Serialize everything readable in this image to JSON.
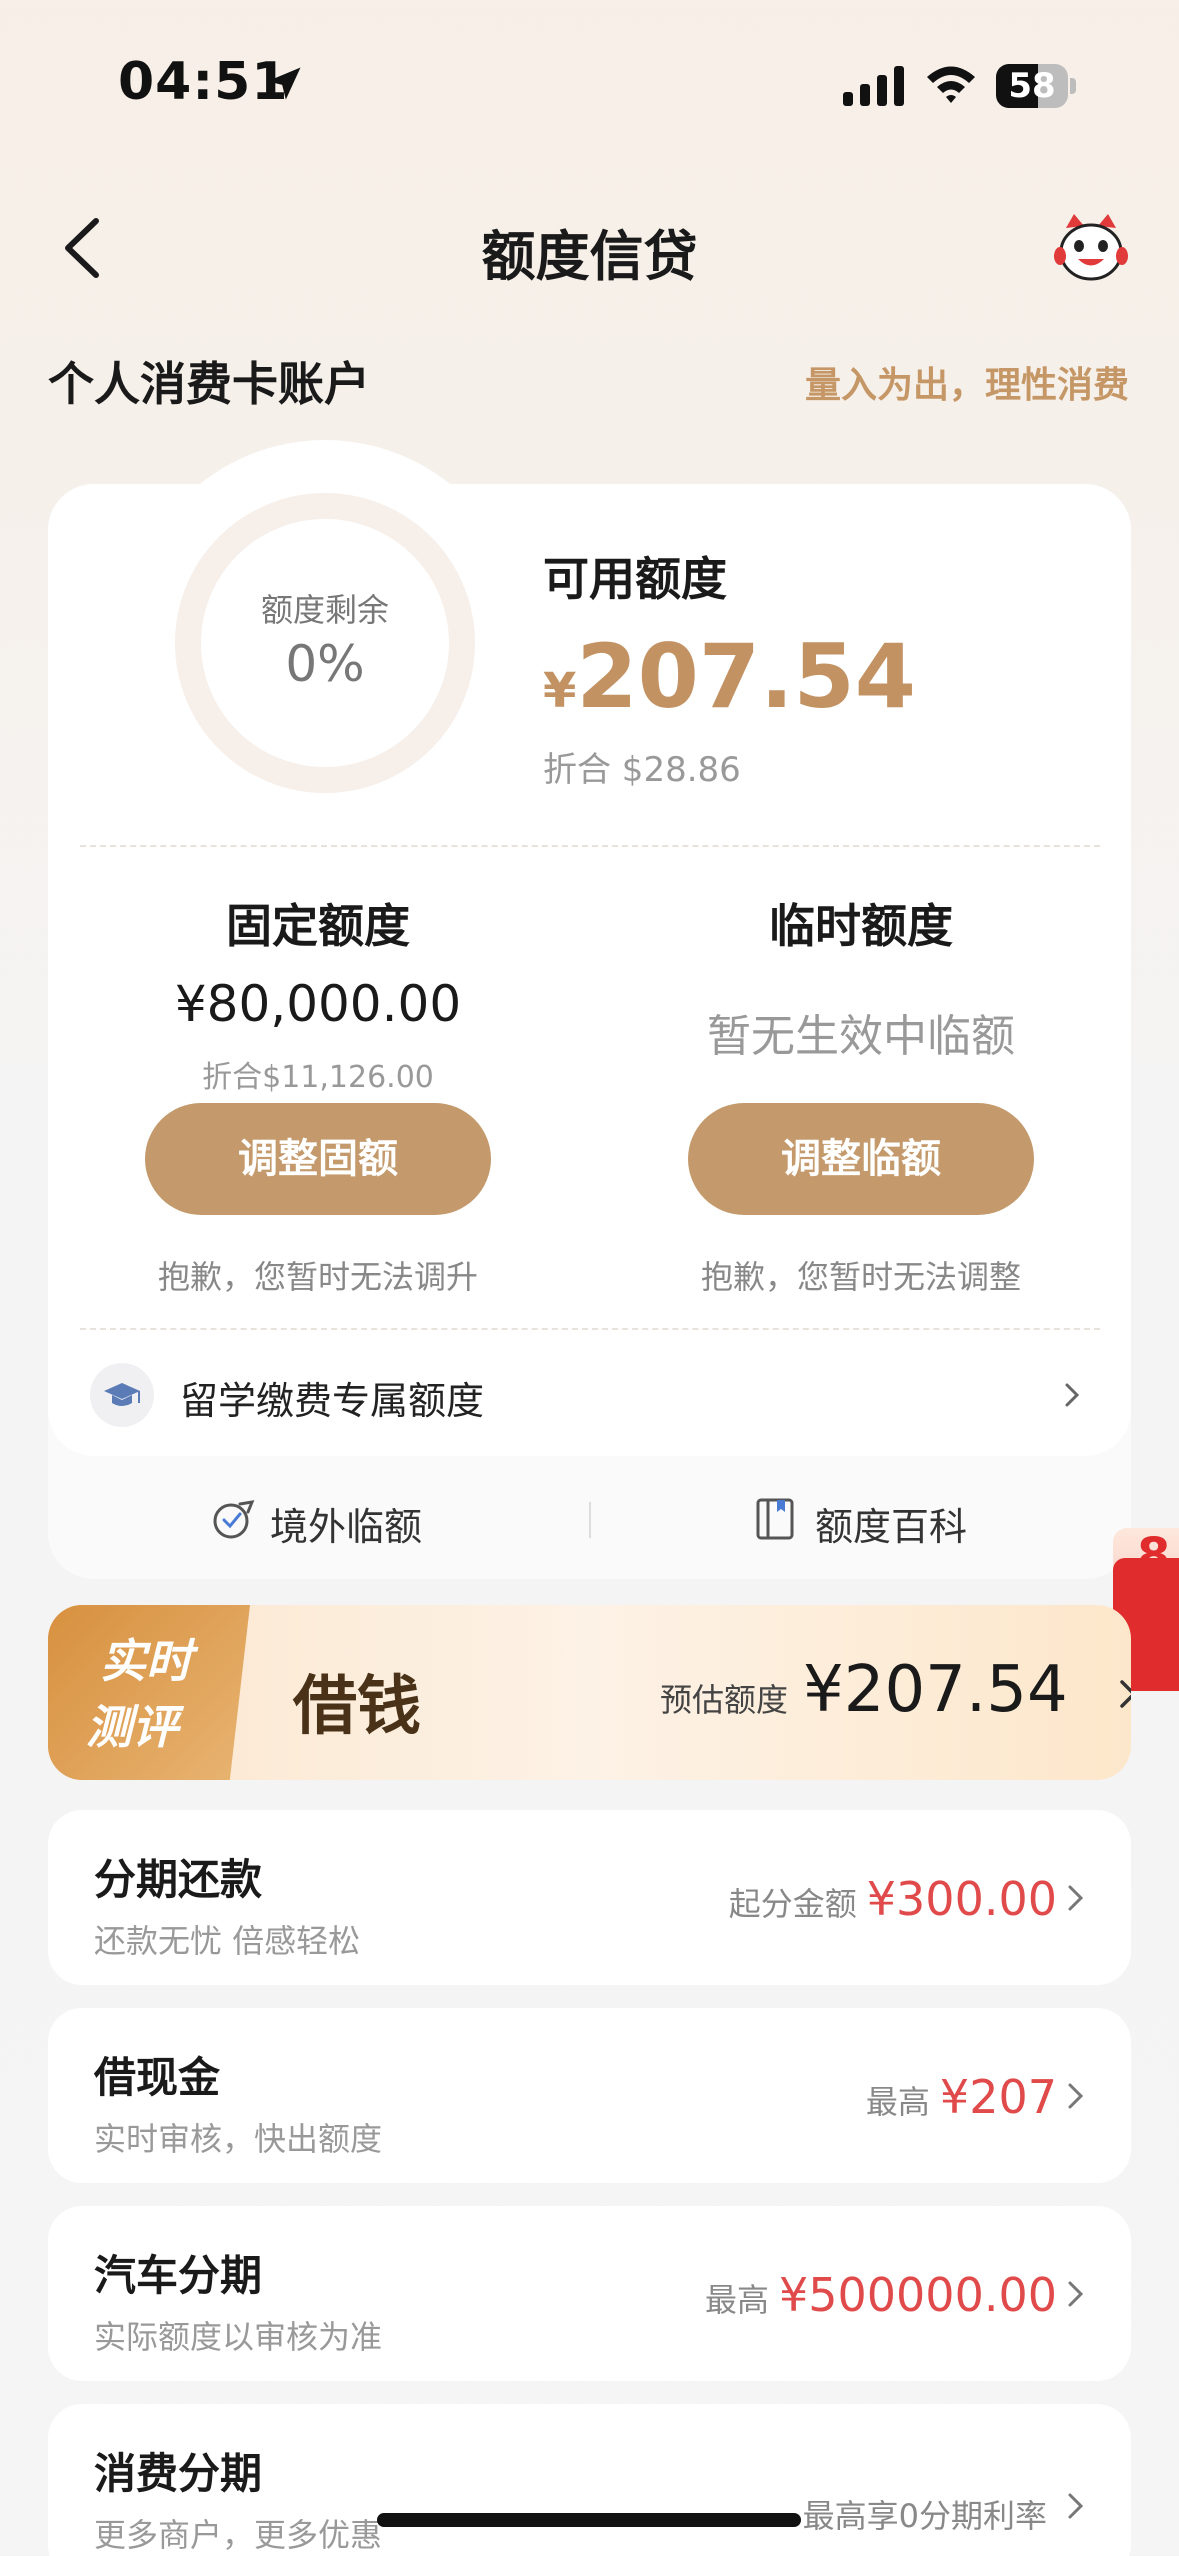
{
  "status_bar": {
    "time": "04:51",
    "battery": "58",
    "battery_level": 0.58
  },
  "nav": {
    "title": "额度信贷"
  },
  "account": {
    "title": "个人消费卡账户",
    "slogan": "量入为出，理性消费"
  },
  "quota": {
    "remaining_label": "额度剩余",
    "remaining_value": "0%",
    "available_label": "可用额度",
    "available_currency": "¥",
    "available_amount": "207.54",
    "available_equiv": "折合  $28.86",
    "fixed_title": "固定额度",
    "fixed_amount": "¥80,000.00",
    "fixed_equiv": "折合$11,126.00",
    "fixed_button": "调整固额",
    "fixed_note": "抱歉，您暂时无法调升",
    "temp_title": "临时额度",
    "temp_status": "暂无生效中临额",
    "temp_button": "调整临额",
    "temp_note": "抱歉，您暂时无法调整",
    "study_label": "留学缴费专属额度",
    "overseas_label": "境外临额",
    "wiki_label": "额度百科"
  },
  "borrow": {
    "tag_line1": "实时",
    "tag_line2": "测评",
    "title": "借钱",
    "est_label": "预估额度",
    "est_value": "¥207.54"
  },
  "list": [
    {
      "title": "分期还款",
      "sub": "还款无忧 倍感轻松",
      "right_label": "起分金额",
      "right_value": "¥300.00"
    },
    {
      "title": "借现金",
      "sub": "实时审核，快出额度",
      "right_label": "最高",
      "right_value": "¥207"
    },
    {
      "title": "汽车分期",
      "sub": "实际额度以审核为准",
      "right_label": "最高",
      "right_value": "¥500000.00"
    },
    {
      "title": "消费分期",
      "sub": "更多商户，更多优惠",
      "right_label": "最高享0分期利率",
      "right_value": ""
    }
  ],
  "side_float": {
    "text": "8"
  },
  "colors": {
    "gold": "#c49a6c",
    "red": "#e04a4a",
    "banner_orange": "#d7903f"
  }
}
